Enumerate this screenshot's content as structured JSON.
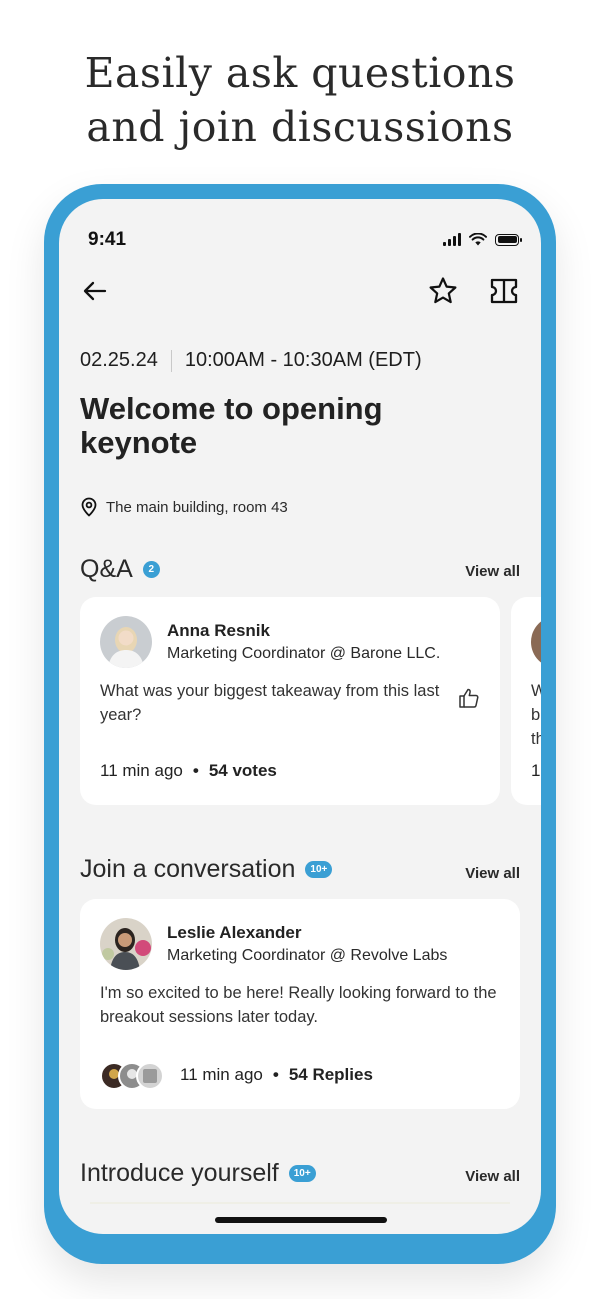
{
  "headline": {
    "line1": "Easily ask questions",
    "line2": "and join discussions"
  },
  "status_bar": {
    "time": "9:41"
  },
  "nav": {
    "back_icon": "arrow-left-icon",
    "favorite_icon": "star-icon",
    "ticket_icon": "ticket-icon"
  },
  "session": {
    "date": "02.25.24",
    "time_range": "10:00AM - 10:30AM (EDT)",
    "title": "Welcome to opening keynote",
    "location": "The main building, room 43"
  },
  "qa": {
    "title": "Q&A",
    "count": "2",
    "view_all": "View all",
    "card": {
      "name": "Anna Resnik",
      "role": "Marketing Coordinator @ Barone LLC.",
      "question": "What was your biggest takeaway from this last year?",
      "time": "11 min ago",
      "votes": "54 votes"
    },
    "peek_card": {
      "text_line1": "W",
      "text_line2": "b",
      "text_line3": "th",
      "time": "1:"
    }
  },
  "conversation": {
    "title": "Join a conversation",
    "count": "10+",
    "view_all": "View all",
    "card": {
      "name": "Leslie Alexander",
      "role": "Marketing Coordinator @ Revolve Labs",
      "message": "I'm so excited to be here! Really looking forward to the breakout sessions later today.",
      "time": "11 min ago",
      "replies": "54 Replies"
    }
  },
  "introduce": {
    "title": "Introduce yourself",
    "count": "10+",
    "view_all": "View all"
  },
  "colors": {
    "accent": "#3a9fd4",
    "screen_bg": "#f3f3f3",
    "card_bg": "#ffffff"
  }
}
